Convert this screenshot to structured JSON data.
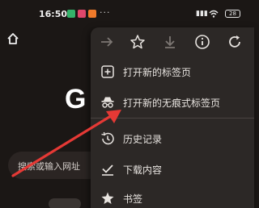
{
  "status_bar": {
    "time": "16:50",
    "more": "···",
    "signal": "▮▮▮",
    "wifi": "◠",
    "battery": "28"
  },
  "page": {
    "google_logo": "G",
    "search_placeholder": "搜索或输入网址"
  },
  "menu": {
    "toolbar": [
      "forward-icon",
      "star-icon",
      "download-icon",
      "info-icon",
      "refresh-icon"
    ],
    "items": [
      {
        "label": "打开新的标签页",
        "icon": "new-tab-icon"
      },
      {
        "label": "打开新的无痕式标签页",
        "icon": "incognito-icon"
      },
      {
        "label": "历史记录",
        "icon": "history-icon"
      },
      {
        "label": "下载内容",
        "icon": "download-check-icon"
      },
      {
        "label": "书签",
        "icon": "bookmark-star-icon"
      }
    ]
  },
  "colors": {
    "background": "#1b1715",
    "menu_bg": "#2c2826",
    "arrow": "#e53935",
    "text": "#e8e4e0"
  }
}
